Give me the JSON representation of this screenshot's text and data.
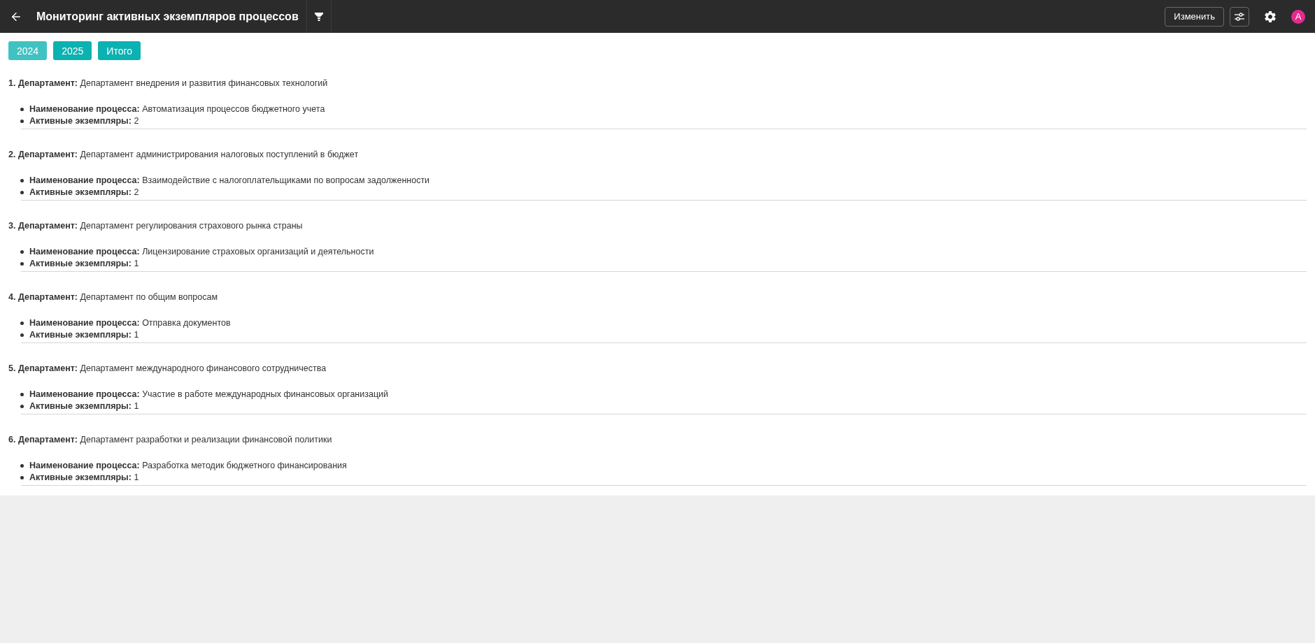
{
  "header": {
    "title": "Мониторинг активных экземпляров процессов",
    "edit_button": "Изменить",
    "avatar": "A"
  },
  "tabs": [
    {
      "label": "2024",
      "selected": true
    },
    {
      "label": "2025",
      "selected": false
    },
    {
      "label": "Итого",
      "selected": false
    }
  ],
  "departments": [
    {
      "heading": "**1. Департамент:** Департамент внедрения и развития финансовых технологий",
      "details": [
        "**Наименование процесса:** Автоматизация процессов бюджетного учета",
        "**Активные экземпляры:** 2"
      ]
    },
    {
      "heading": "**2. Департамент:** Департамент администрирования налоговых поступлений в бюджет",
      "details": [
        "**Наименование процесса:** Взаимодействие с налогоплательщиками по вопросам задолженности",
        "**Активные экземпляры:** 2"
      ]
    },
    {
      "heading": "**3. Департамент:** Департамент регулирования страхового рынка страны",
      "details": [
        "**Наименование процесса:** Лицензирование страховых организаций и деятельности",
        "**Активные экземпляры:** 1"
      ]
    },
    {
      "heading": "**4. Департамент:** Департамент по общим вопросам",
      "details": [
        "**Наименование процесса:** Отправка документов",
        "**Активные экземпляры:** 1"
      ]
    },
    {
      "heading": "**5. Департамент:** Департамент международного финансового сотрудничества",
      "details": [
        "**Наименование процесса:** Участие в работе международных финансовых организаций",
        "**Активные экземпляры:** 1"
      ]
    },
    {
      "heading": "**6. Департамент:** Департамент разработки и реализации финансовой политики",
      "details": [
        "**Наименование процесса:** Разработка методик бюджетного финансирования",
        "**Активные экземпляры:** 1"
      ]
    }
  ]
}
